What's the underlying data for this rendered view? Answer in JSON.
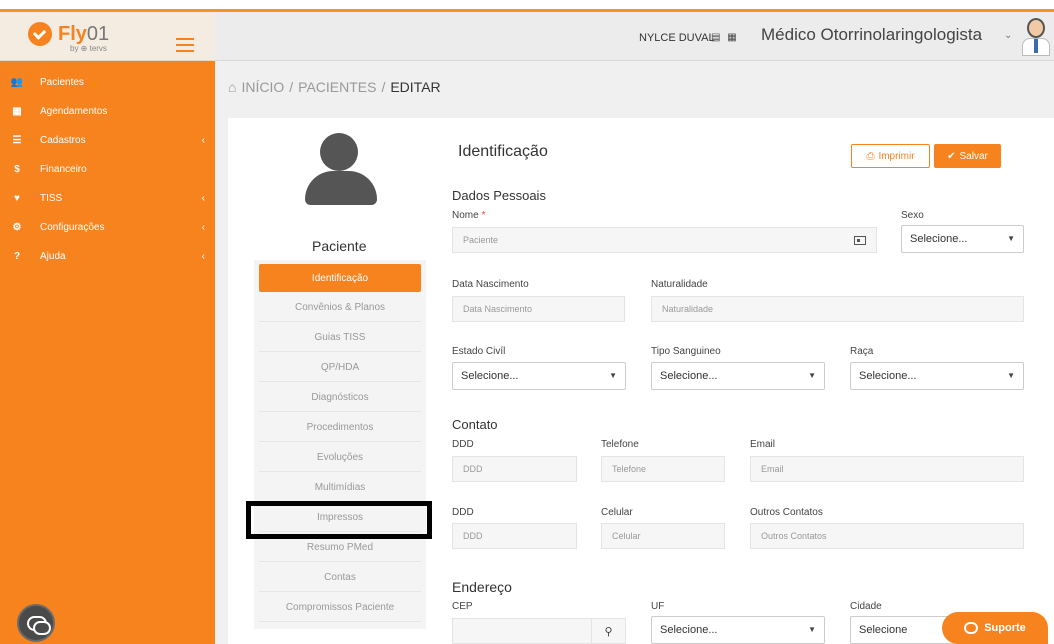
{
  "brand": {
    "name": "Fly",
    "suffix": "01",
    "sub": "by ⊕ tervs"
  },
  "header": {
    "user": "NYLCE DUVAL",
    "role": "Médico Otorrinolaringologista",
    "icons": [
      "id-card-icon",
      "grid-icon"
    ]
  },
  "sidebar": {
    "items": [
      {
        "label": "Pacientes",
        "icon": "users-icon",
        "glyph": "👥",
        "arrow": false
      },
      {
        "label": "Agendamentos",
        "icon": "calendar-icon",
        "glyph": "▦",
        "arrow": false
      },
      {
        "label": "Cadastros",
        "icon": "list-icon",
        "glyph": "☰",
        "arrow": true
      },
      {
        "label": "Financeiro",
        "icon": "dollar-icon",
        "glyph": "$",
        "arrow": false
      },
      {
        "label": "TISS",
        "icon": "heart-icon",
        "glyph": "♥",
        "arrow": true
      },
      {
        "label": "Configurações",
        "icon": "gear-icon",
        "glyph": "⚙",
        "arrow": true
      },
      {
        "label": "Ajuda",
        "icon": "question-icon",
        "glyph": "?",
        "arrow": true
      }
    ]
  },
  "breadcrumb": {
    "home": "INÍCIO",
    "sep1": "/",
    "section": "PACIENTES",
    "sep2": "/",
    "current": "EDITAR"
  },
  "patient": {
    "label": "Paciente"
  },
  "tabs": [
    "Identificação",
    "Convênios & Planos",
    "Guias TISS",
    "QP/HDA",
    "Diagnósticos",
    "Procedimentos",
    "Evoluções",
    "Multimídias",
    "Impressos",
    "Resumo PMed",
    "Contas",
    "Compromissos Paciente"
  ],
  "active_tab": "Identificação",
  "form": {
    "title": "Identificação",
    "print_label": "Imprimir",
    "save_label": "Salvar",
    "dados_pessoais": "Dados Pessoais",
    "nome_label": "Nome",
    "nome_required": "*",
    "nome_placeholder": "Paciente",
    "sexo_label": "Sexo",
    "sexo_value": "Selecione...",
    "nasc_label": "Data Nascimento",
    "nasc_placeholder": "Data Nascimento",
    "natural_label": "Naturalidade",
    "natural_placeholder": "Naturalidade",
    "estado_label": "Estado Civíl",
    "estado_value": "Selecione...",
    "sangue_label": "Tipo Sanguineo",
    "sangue_value": "Selecione...",
    "raca_label": "Raça",
    "raca_value": "Selecione...",
    "contato": "Contato",
    "ddd_label": "DDD",
    "ddd_placeholder": "DDD",
    "telefone_label": "Telefone",
    "telefone_placeholder": "Telefone",
    "email_label": "Email",
    "email_placeholder": "Email",
    "ddd2_label": "DDD",
    "ddd2_placeholder": "DDD",
    "celular_label": "Celular",
    "celular_placeholder": "Celular",
    "outros_label": "Outros Contatos",
    "outros_placeholder": "Outros Contatos",
    "endereco": "Endereço",
    "cep_label": "CEP",
    "uf_label": "UF",
    "uf_value": "Selecione...",
    "cidade_label": "Cidade",
    "cidade_value": "Selecione"
  },
  "support": {
    "label": "Suporte"
  },
  "colors": {
    "accent": "#f7831f",
    "sidebar": "#f7831f",
    "header_bg": "#ececec"
  }
}
